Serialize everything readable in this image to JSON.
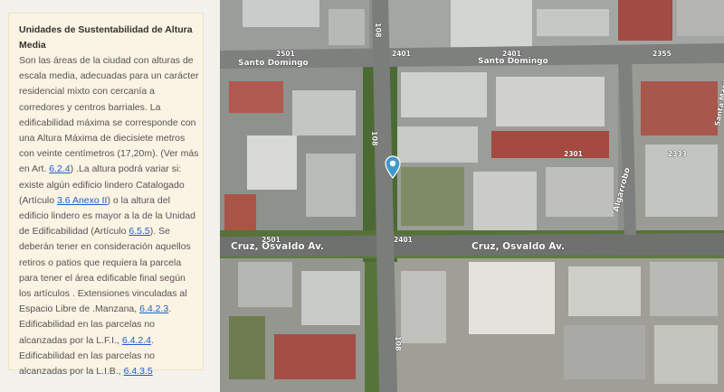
{
  "panel": {
    "title": "Unidades de Sustentabilidad de Altura Media",
    "t1": "Son las áreas de la ciudad con alturas de escala media, adecuadas para un carácter residencial mixto con cercanía a corredores y centros barriales. La edificabilidad máxima se corresponde con una Altura Máxima de diecisiete metros con veinte centímetros (17,20m). (Ver más en Art. ",
    "l1": "6.2.4",
    "t2": ") .La altura podrá variar si: existe algún edificio lindero Catalogado (Artículo ",
    "l2": "3.6 Anexo II",
    "t3": ") o la altura del edificio lindero es mayor a la de la Unidad de Edificabilidad (Artículo ",
    "l3": "6.5.5",
    "t4": "). Se deberán tener en consideración aquellos retiros o patios que requiera la parcela para tener el área edificable final según los artículos . Extensiones vinculadas al Espacio Libre de .Manzana, ",
    "l4": "6.4.2.3",
    "t5": ". Edificabilidad en las parcelas no alcanzadas por la L.F.I., ",
    "l5": "6.4.2.4",
    "t6": ". Edificabilidad en las parcelas no alcanzadas por la L.I.B., ",
    "l6": "6.4.3.5"
  },
  "map": {
    "streets": {
      "santo_domingo_left": "Santo Domingo",
      "santo_domingo_right": "Santo Domingo",
      "cruz_left": "Cruz, Osvaldo Av.",
      "cruz_right": "Cruz, Osvaldo Av.",
      "algarrobo": "Algarrobo",
      "santa_maria": "Santa María",
      "v108_top": "108",
      "v108_mid": "108",
      "v108_bottom": "108"
    },
    "numbers": {
      "n2501_top": "2501",
      "n2401_top": "2401",
      "n2401_top_r": "2401",
      "n2355": "2355",
      "n2301": "2301",
      "n2333": "2333",
      "n2501_bottom": "2501",
      "n2401_bottom": "2401"
    }
  }
}
